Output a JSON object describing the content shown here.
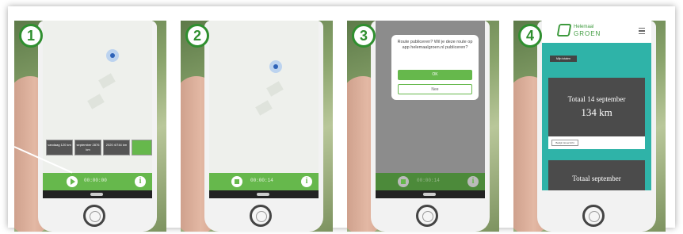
{
  "panels": [
    {
      "step": "1",
      "stats": [
        "vandaag 120 km",
        "september 2876 km",
        "2020 4/744 km",
        ""
      ],
      "timer": "00:00:00"
    },
    {
      "step": "2",
      "timer": "00:00:14"
    },
    {
      "step": "3",
      "dialog": {
        "text": "Route publiceren? Wil je deze route op app helemaalgroen.nl publiceren?",
        "ok": "OK",
        "nee": "Nee"
      },
      "timer": "00:00:14"
    },
    {
      "step": "4",
      "logo_line1": "Helemaal",
      "logo_line2": "GROEN",
      "tab_label": "Mijn totalen",
      "card1_title": "Totaal 14 september",
      "card1_value": "134 km",
      "button_label": "Bekijk ritoverzicht",
      "card2_title": "Totaal september"
    }
  ],
  "colors": {
    "accent_green": "#66b84c",
    "teal": "#2fb3a8",
    "badge_green": "#2f8f2f"
  }
}
